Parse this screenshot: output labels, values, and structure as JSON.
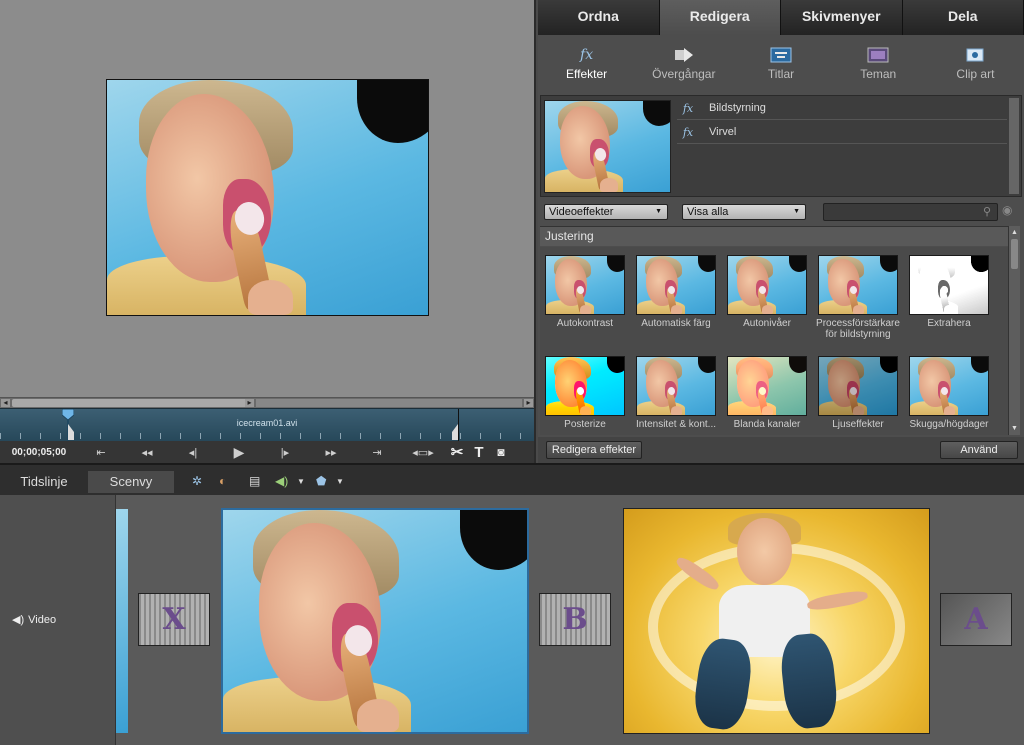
{
  "main_tabs": [
    "Ordna",
    "Redigera",
    "Skivmenyer",
    "Dela"
  ],
  "sub_tools": [
    {
      "label": "Effekter",
      "icon": "fx-icon"
    },
    {
      "label": "Övergångar",
      "icon": "transition-icon"
    },
    {
      "label": "Titlar",
      "icon": "title-icon"
    },
    {
      "label": "Teman",
      "icon": "theme-icon"
    },
    {
      "label": "Clip art",
      "icon": "clipart-icon"
    }
  ],
  "applied_effects": [
    "Bildstyrning",
    "Virvel"
  ],
  "filters": {
    "category": "Videoeffekter",
    "show": "Visa alla"
  },
  "category_title": "Justering",
  "effects": [
    "Autokontrast",
    "Automatisk färg",
    "Autonivåer",
    "Processförstärkare för bildstyrning",
    "Extrahera",
    "Posterize",
    "Intensitet & kont...",
    "Blanda kanaler",
    "Ljuseffekter",
    "Skugga/högdager"
  ],
  "buttons": {
    "edit_effects": "Redigera effekter",
    "apply": "Använd"
  },
  "monitor": {
    "clip_name": "icecream01.avi",
    "timecode": "00;00;05;00"
  },
  "timeline": {
    "tabs": [
      "Tidslinje",
      "Scenvy"
    ],
    "track_label": "Video"
  },
  "transitions": [
    "X",
    "B",
    "A"
  ],
  "colors": {
    "accent": "#9cc4e6",
    "panel": "#4d4d4d",
    "active_tab": "#5e5e5e"
  }
}
